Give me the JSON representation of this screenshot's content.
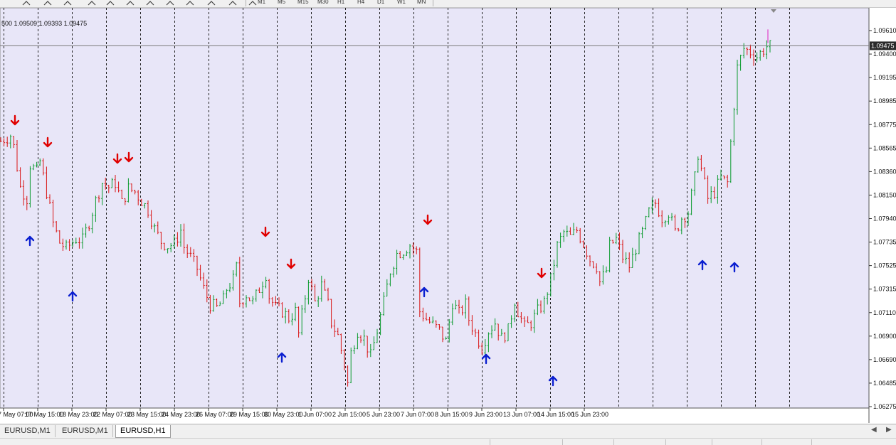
{
  "toolbar": {
    "buttons": [
      "line-tool-icon",
      "trendline-tool-icon",
      "fib-tool-icon",
      "text-tool-icon",
      "label-tool-icon",
      "period-tool-icon",
      "zoom-in-icon",
      "zoom-out-icon",
      "grid-icon",
      "autoscroll-icon",
      "chart-shift-icon",
      "indicators-icon"
    ],
    "timeframes": [
      "M1",
      "M5",
      "M15",
      "M30",
      "H1",
      "H4",
      "D1",
      "W1",
      "MN"
    ]
  },
  "chart": {
    "ohlc_text": "500 1.09509 1.09393 1.09475",
    "current_price": "1.09475",
    "colors": {
      "background": "#e8e6f8",
      "bull": "#0a9a2e",
      "bear": "#d81414",
      "grid": "#222222",
      "buy_arrow": "#0b1fd0",
      "sell_arrow": "#e00000",
      "price_line": "#7a7a7a"
    }
  },
  "chart_data": {
    "type": "candlestick",
    "symbol": "EURUSD",
    "timeframe": "H1",
    "y_ticks": [
      "1.09610",
      "1.09400",
      "1.09195",
      "1.08985",
      "1.08775",
      "1.08565",
      "1.08360",
      "1.08150",
      "1.07940",
      "1.07735",
      "1.07525",
      "1.07315",
      "1.07110",
      "1.06900",
      "1.06690",
      "1.06485",
      "1.06275"
    ],
    "x_ticks": [
      "17 May 07:00",
      "17 May 15:00",
      "18 May 23:00",
      "22 May 07:00",
      "23 May 15:00",
      "24 May 23:00",
      "26 May 07:00",
      "29 May 15:00",
      "30 May 23:00",
      "1 Jun 07:00",
      "2 Jun 15:00",
      "5 Jun 23:00",
      "7 Jun 07:00",
      "8 Jun 15:00",
      "9 Jun 23:00",
      "13 Jun 07:00",
      "14 Jun 15:00",
      "15 Jun 23:00"
    ],
    "ylim": [
      1.0622,
      1.098
    ],
    "price_path": [
      [
        0,
        1.0863
      ],
      [
        3,
        1.0868
      ],
      [
        4,
        1.0858
      ],
      [
        6,
        1.0822
      ],
      [
        8,
        1.0812
      ],
      [
        9,
        1.0842
      ],
      [
        11,
        1.0836
      ],
      [
        12,
        1.0845
      ],
      [
        14,
        1.0818
      ],
      [
        16,
        1.079
      ],
      [
        18,
        1.0773
      ],
      [
        20,
        1.0768
      ],
      [
        23,
        1.0776
      ],
      [
        25,
        1.0775
      ],
      [
        27,
        1.0791
      ],
      [
        29,
        1.081
      ],
      [
        31,
        1.0826
      ],
      [
        33,
        1.0822
      ],
      [
        35,
        1.0826
      ],
      [
        37,
        1.0808
      ],
      [
        39,
        1.0821
      ],
      [
        41,
        1.0818
      ],
      [
        43,
        1.081
      ],
      [
        45,
        1.0802
      ],
      [
        47,
        1.0785
      ],
      [
        49,
        1.0774
      ],
      [
        51,
        1.077
      ],
      [
        53,
        1.0772
      ],
      [
        55,
        1.0784
      ],
      [
        56,
        1.0769
      ],
      [
        58,
        1.076
      ],
      [
        60,
        1.075
      ],
      [
        62,
        1.0732
      ],
      [
        64,
        1.0718
      ],
      [
        66,
        1.0715
      ],
      [
        68,
        1.0722
      ],
      [
        69,
        1.0732
      ],
      [
        71,
        1.074
      ],
      [
        72,
        1.0751
      ],
      [
        73,
        1.072
      ],
      [
        75,
        1.0727
      ],
      [
        77,
        1.072
      ],
      [
        79,
        1.0732
      ],
      [
        81,
        1.0745
      ],
      [
        82,
        1.0725
      ],
      [
        84,
        1.0715
      ],
      [
        86,
        1.0712
      ],
      [
        88,
        1.0706
      ],
      [
        90,
        1.0712
      ],
      [
        91,
        1.0692
      ],
      [
        93,
        1.0725
      ],
      [
        94,
        1.0742
      ],
      [
        96,
        1.072
      ],
      [
        98,
        1.0735
      ],
      [
        100,
        1.0718
      ],
      [
        101,
        1.0702
      ],
      [
        103,
        1.069
      ],
      [
        105,
        1.0665
      ],
      [
        106,
        1.0648
      ],
      [
        107,
        1.0675
      ],
      [
        109,
        1.0695
      ],
      [
        111,
        1.0688
      ],
      [
        113,
        1.0672
      ],
      [
        115,
        1.0695
      ],
      [
        117,
        1.072
      ],
      [
        119,
        1.0748
      ],
      [
        121,
        1.0763
      ],
      [
        123,
        1.0766
      ],
      [
        125,
        1.0771
      ],
      [
        127,
        1.0765
      ],
      [
        128,
        1.0712
      ],
      [
        130,
        1.0705
      ],
      [
        132,
        1.07
      ],
      [
        134,
        1.0695
      ],
      [
        136,
        1.0685
      ],
      [
        138,
        1.072
      ],
      [
        140,
        1.071
      ],
      [
        142,
        1.0718
      ],
      [
        143,
        1.0705
      ],
      [
        145,
        1.0692
      ],
      [
        147,
        1.068
      ],
      [
        149,
        1.0695
      ],
      [
        151,
        1.0702
      ],
      [
        153,
        1.0688
      ],
      [
        155,
        1.0695
      ],
      [
        157,
        1.0722
      ],
      [
        158,
        1.0712
      ],
      [
        160,
        1.0698
      ],
      [
        162,
        1.0702
      ],
      [
        164,
        1.0712
      ],
      [
        166,
        1.072
      ],
      [
        168,
        1.074
      ],
      [
        170,
        1.077
      ],
      [
        172,
        1.0782
      ],
      [
        174,
        1.0778
      ],
      [
        176,
        1.0784
      ],
      [
        178,
        1.0772
      ],
      [
        180,
        1.0758
      ],
      [
        182,
        1.0752
      ],
      [
        183,
        1.0738
      ],
      [
        185,
        1.0748
      ],
      [
        186,
        1.077
      ],
      [
        188,
        1.0776
      ],
      [
        190,
        1.076
      ],
      [
        192,
        1.0752
      ],
      [
        194,
        1.0768
      ],
      [
        196,
        1.0782
      ],
      [
        198,
        1.08
      ],
      [
        200,
        1.0808
      ],
      [
        202,
        1.0795
      ],
      [
        204,
        1.08
      ],
      [
        206,
        1.0782
      ],
      [
        208,
        1.0795
      ],
      [
        210,
        1.08
      ],
      [
        212,
        1.083
      ],
      [
        213,
        1.0852
      ],
      [
        214,
        1.0838
      ],
      [
        215,
        1.0825
      ],
      [
        216,
        1.0812
      ],
      [
        218,
        1.0818
      ],
      [
        220,
        1.083
      ],
      [
        222,
        1.0826
      ],
      [
        223,
        1.0862
      ],
      [
        224,
        1.0895
      ],
      [
        225,
        1.0928
      ],
      [
        227,
        1.0945
      ],
      [
        229,
        1.0942
      ],
      [
        231,
        1.0938
      ],
      [
        233,
        1.0944
      ],
      [
        234,
        1.0947
      ]
    ],
    "arrows": [
      {
        "type": "sell",
        "x": "17 May 07:00"
      },
      {
        "type": "buy",
        "x": "17 May 07:00"
      },
      {
        "type": "sell",
        "x": "17 May 15:00"
      },
      {
        "type": "buy",
        "x": "18 May 23:00"
      },
      {
        "type": "sell",
        "x": "22 May 07:00"
      },
      {
        "type": "sell",
        "x": "22 May 07:00"
      },
      {
        "type": "sell",
        "x": "26 May 07:00"
      },
      {
        "type": "sell",
        "x": "26 May 07:00"
      },
      {
        "type": "buy",
        "x": "26 May 07:00"
      },
      {
        "type": "sell",
        "x": "1 Jun 07:00"
      },
      {
        "type": "buy",
        "x": "1 Jun 07:00"
      },
      {
        "type": "buy",
        "x": "5 Jun 23:00"
      },
      {
        "type": "sell",
        "x": "7 Jun 07:00"
      },
      {
        "type": "buy",
        "x": "7 Jun 07:00"
      },
      {
        "type": "buy",
        "x": "13 Jun 07:00"
      },
      {
        "type": "buy",
        "x": "14 Jun 15:00"
      }
    ]
  },
  "tabs": [
    {
      "label": "EURUSD,M1",
      "active": false
    },
    {
      "label": "EURUSD,M1",
      "active": false
    },
    {
      "label": "EURUSD,H1",
      "active": true
    }
  ]
}
